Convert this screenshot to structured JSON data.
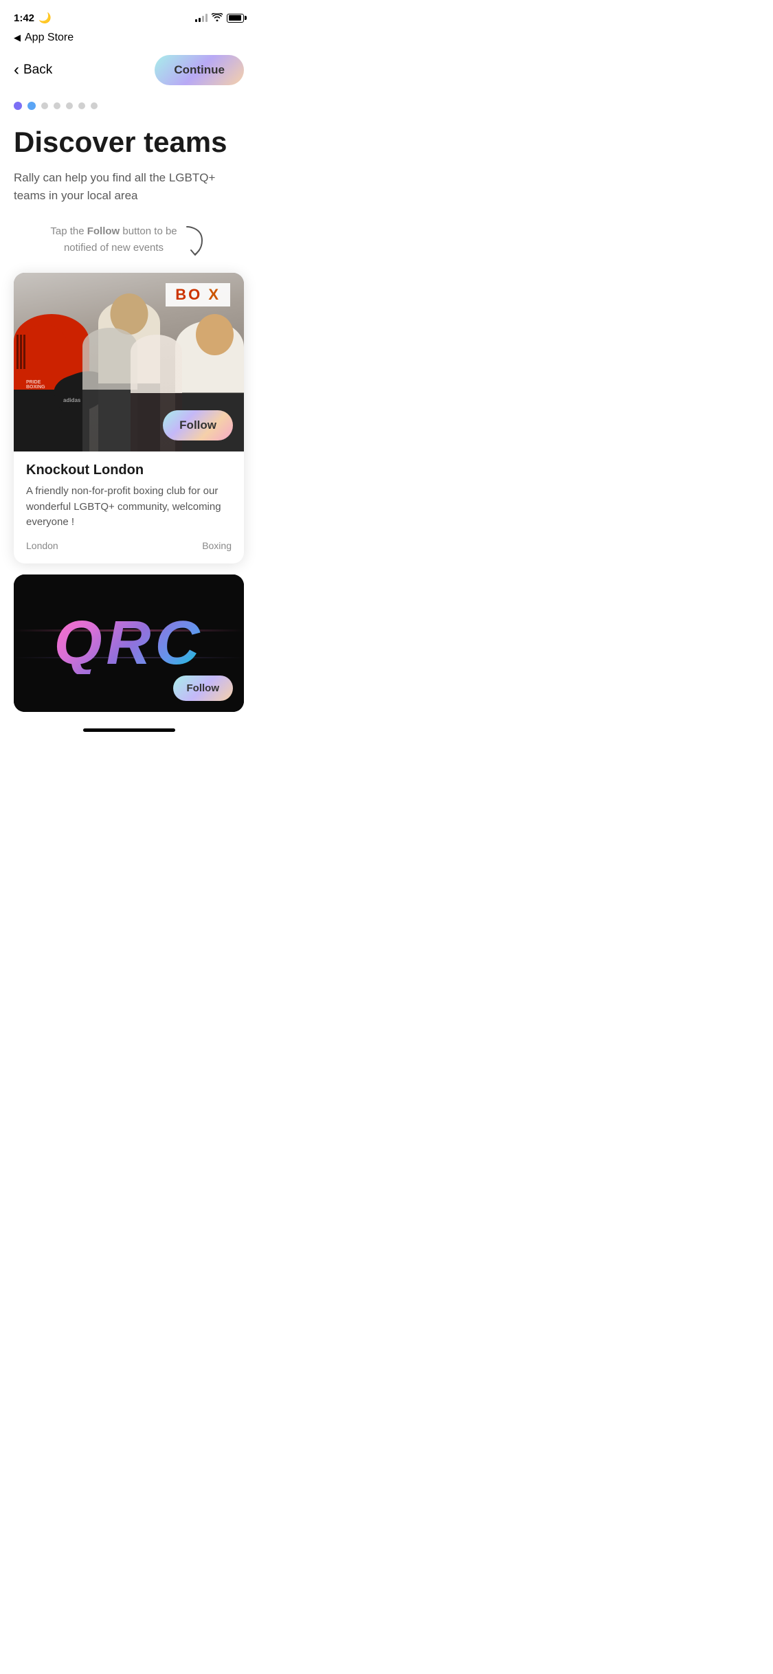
{
  "statusBar": {
    "time": "1:42",
    "moonIcon": "🌙"
  },
  "appStoreNav": {
    "backLabel": "App Store",
    "backIcon": "◀"
  },
  "nav": {
    "backLabel": "Back",
    "backIcon": "‹",
    "continueLabel": "Continue"
  },
  "progressDots": {
    "total": 7,
    "activeIndex": [
      0,
      1
    ]
  },
  "page": {
    "title": "Discover teams",
    "subtitle": "Rally can help you find all the LGBTQ+ teams in your local area",
    "tapInstruction": {
      "prefix": "Tap the ",
      "bold": "Follow",
      "suffix": " button to be notified of new events"
    }
  },
  "card1": {
    "teamName": "Knockout London",
    "description": "A friendly non-for-profit boxing club for our wonderful LGBTQ+ community, welcoming everyone !",
    "location": "London",
    "sport": "Boxing",
    "followLabel": "Follow"
  },
  "card2": {
    "teamName": "QRC",
    "followLabel": "Follow"
  }
}
